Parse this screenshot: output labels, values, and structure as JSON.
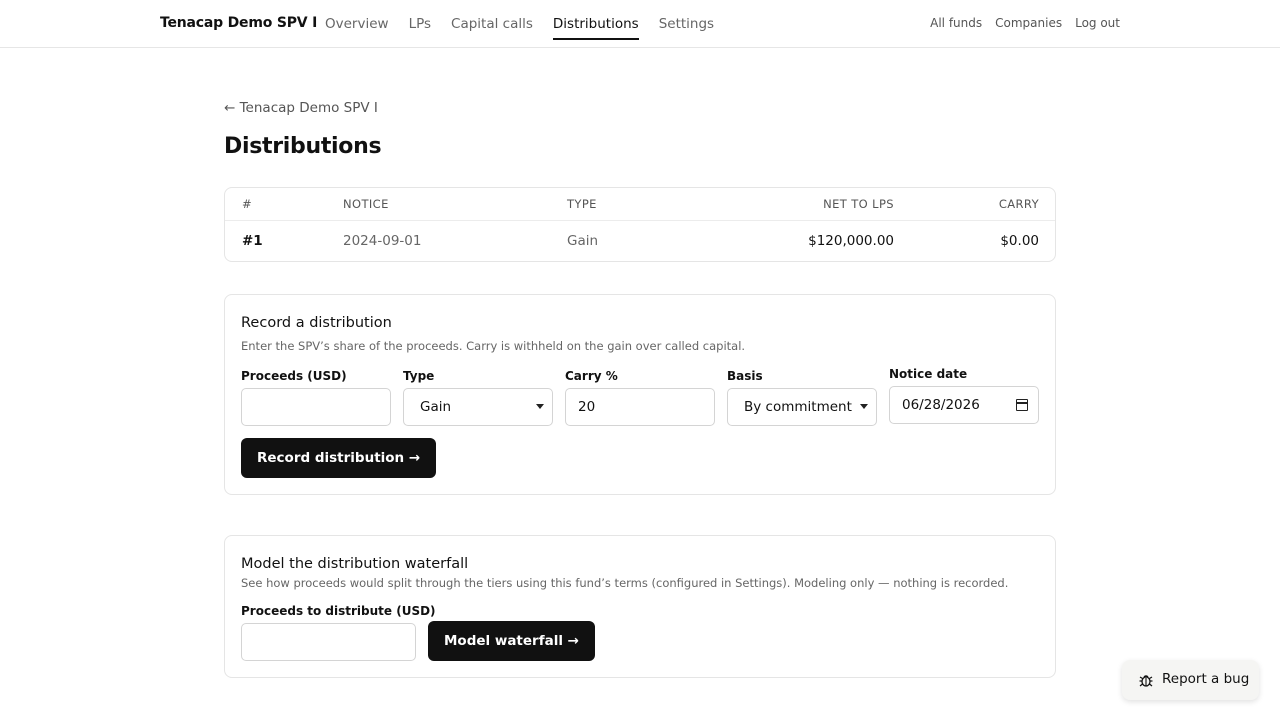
{
  "nav": {
    "brand": "Tenacap Demo SPV I",
    "tabs": [
      {
        "label": "Overview"
      },
      {
        "label": "LPs"
      },
      {
        "label": "Capital calls"
      },
      {
        "label": "Distributions"
      },
      {
        "label": "Settings"
      }
    ],
    "active_tab": "Distributions",
    "right": [
      "All funds",
      "Companies",
      "Log out"
    ]
  },
  "back_link": "← Tenacap Demo SPV I",
  "page_title": "Distributions",
  "table": {
    "headers": [
      "#",
      "NOTICE",
      "TYPE",
      "NET TO LPS",
      "CARRY"
    ],
    "rows": [
      {
        "num": "#1",
        "notice": "2024-09-01",
        "type": "Gain",
        "net": "$120,000.00",
        "carry": "$0.00"
      }
    ]
  },
  "record": {
    "title": "Record a distribution",
    "subtitle": "Enter the SPV’s share of the proceeds. Carry is withheld on the gain over called capital.",
    "proceeds_label": "Proceeds (USD)",
    "proceeds_value": "",
    "type_label": "Type",
    "type_value": "Gain",
    "carry_label": "Carry %",
    "carry_value": "20",
    "basis_label": "Basis",
    "basis_value": "By commitment",
    "date_label": "Notice date",
    "date_value": "06/28/2026",
    "button": "Record distribution →"
  },
  "waterfall": {
    "title": "Model the distribution waterfall",
    "subtitle": "See how proceeds would split through the tiers using this fund’s terms (configured in Settings). Modeling only — nothing is recorded.",
    "proceeds_label": "Proceeds to distribute (USD)",
    "proceeds_value": "",
    "button": "Model waterfall →"
  },
  "bug_button": "Report a bug",
  "icons": [
    "bug-icon",
    "calendar-icon",
    "chevron-down-icon"
  ]
}
